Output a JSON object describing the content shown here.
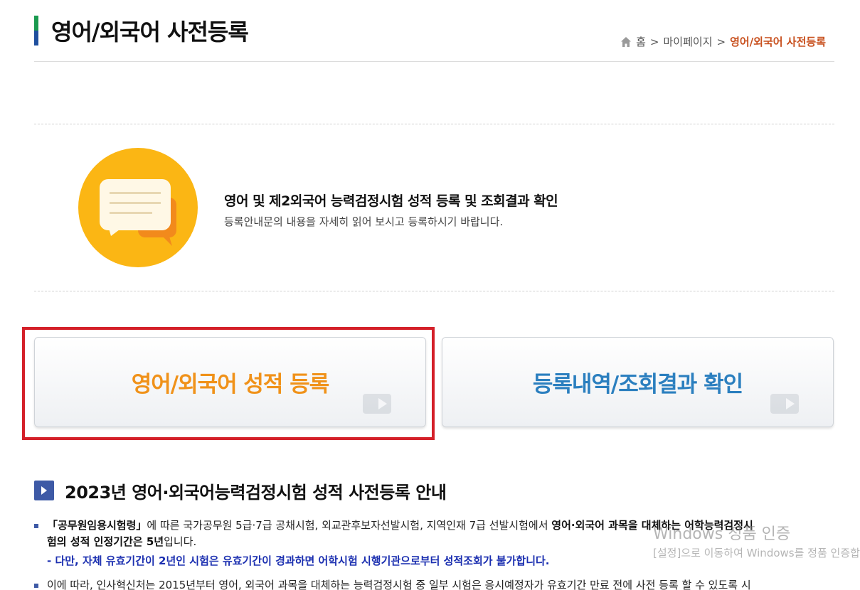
{
  "page": {
    "title": "영어/외국어 사전등록"
  },
  "breadcrumb": {
    "home": "홈",
    "sep1": ">",
    "mypage": "마이페이지",
    "sep2": ">",
    "current": "영어/외국어 사전등록"
  },
  "intro": {
    "heading": "영어 및 제2외국어 능력검정시험 성적 등록 및 조회결과 확인",
    "subtext": "등록안내문의 내용을 자세히 읽어 보시고 등록하시기 바랍니다."
  },
  "buttons": {
    "register_label": "영어/외국어 성적 등록",
    "result_label": "등록내역/조회결과 확인"
  },
  "section": {
    "title": "2023년 영어·외국어능력검정시험 성적 사전등록 안내"
  },
  "notice": {
    "p1_line1_a": "「공무원임용시험령」",
    "p1_line1_b": "에 따른 국가공무원 5급·7급 공채시험, 외교관후보자선발시험, 지역인재 7급 선발시험에서 ",
    "p1_line1_c": "영어·외국어 과목을 대체하는 어학능력검정시",
    "p1_line2_a": "험의 성적 인정기간은 5년",
    "p1_line2_b": "입니다.",
    "p1_note": "- 다만, 자체 유효기간이 2년인 시험은 유효기간이 경과하면 어학시험 시행기관으로부터 성적조회가 불가합니다.",
    "p2_line1": "이에 따라, 인사혁신처는 2015년부터 영어, 외국어 과목을 대체하는 능력검정시험 중 일부 시험은 응시예정자가 유효기간 만료 전에 사전 등록 할 수 있도록 시"
  },
  "watermark": {
    "line1": "Windows 정품 인증",
    "line2": "[설정]으로 이동하여 Windows를 정품 인증합니다."
  },
  "colors": {
    "accent_orange": "#f0921a",
    "accent_blue": "#2b7fbf",
    "highlight_red": "#d42029",
    "breadcrumb_current": "#c8501e",
    "notice_blue": "#1b2fb0",
    "icon_yellow": "#fbb614"
  },
  "icons": {
    "home": "home-icon",
    "intro": "chat-bubbles-icon",
    "section": "play-arrow-icon"
  }
}
